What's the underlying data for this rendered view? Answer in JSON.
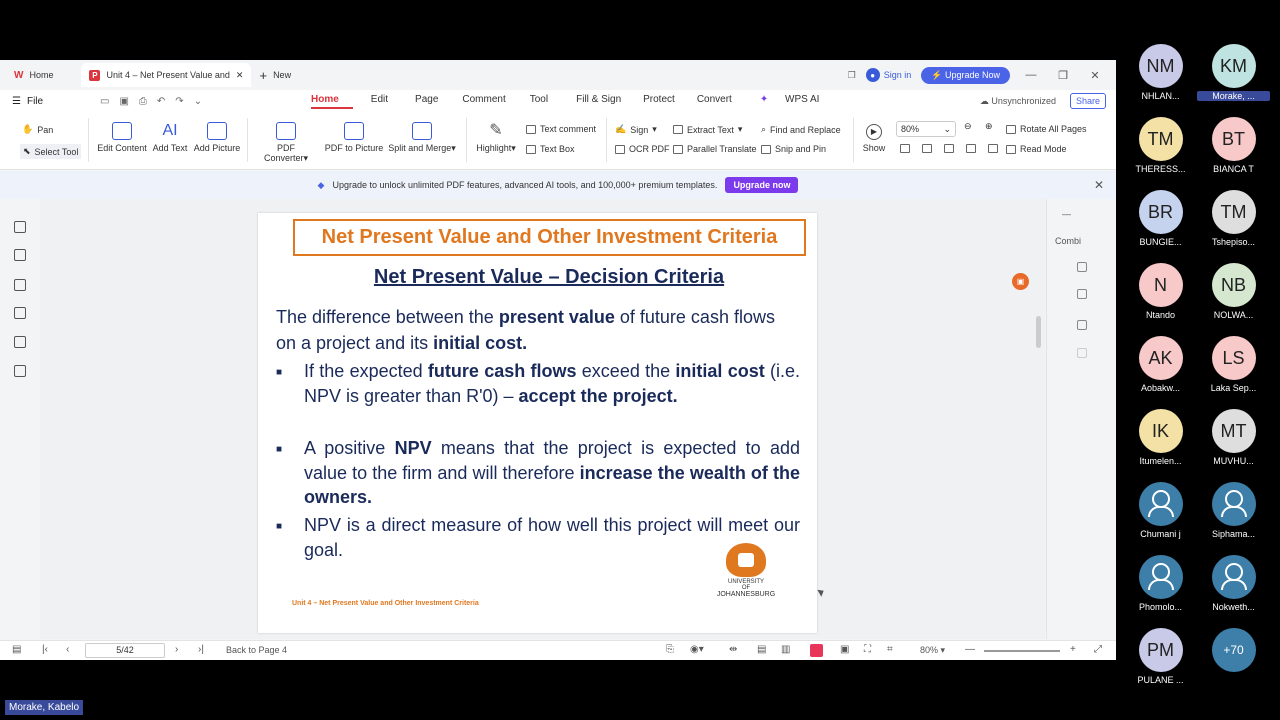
{
  "tabs": {
    "home": "Home",
    "active_doc": "Unit 4 – Net Present Value and",
    "new": "New"
  },
  "top_right": {
    "sign_in": "Sign in",
    "upgrade_now": "Upgrade Now"
  },
  "menu": {
    "file": "File",
    "tabs": [
      "Home",
      "Edit",
      "Page",
      "Comment",
      "Tool",
      "Fill & Sign",
      "Protect",
      "Convert",
      "WPS AI"
    ],
    "unsynchronized": "Unsynchronized",
    "share": "Share"
  },
  "ribbon": {
    "pan": "Pan",
    "select_tool": "Select Tool",
    "edit_content": "Edit Content",
    "add_text": "Add Text",
    "add_picture": "Add Picture",
    "pdf_converter": "PDF Converter",
    "pdf_to_picture": "PDF to Picture",
    "split_merge": "Split and Merge",
    "highlight": "Highlight",
    "text_comment": "Text comment",
    "text_box": "Text Box",
    "sign": "Sign",
    "ocr_pdf": "OCR PDF",
    "extract_text": "Extract Text",
    "parallel_translate": "Parallel Translate",
    "find_replace": "Find and Replace",
    "snip_pin": "Snip and Pin",
    "show": "Show",
    "zoom": "80%",
    "rotate_all": "Rotate All Pages",
    "read_mode": "Read Mode"
  },
  "banner": {
    "text": "Upgrade to unlock unlimited PDF features, advanced AI tools, and 100,000+ premium templates.",
    "button": "Upgrade now"
  },
  "slide": {
    "title": "Net Present Value and Other Investment Criteria",
    "subtitle": "Net Present Value – Decision Criteria",
    "intro_a": "The difference between the ",
    "intro_b": "present value",
    "intro_c": " of future cash flows on a project and its ",
    "intro_d": "initial cost.",
    "b1_a": "If the expected ",
    "b1_b": "future cash flows",
    "b1_c": " exceed the ",
    "b1_d": "initial cost",
    "b1_e": " (i.e. NPV is greater than R'0) – ",
    "b1_f": "accept the project.",
    "b2_a": "A positive ",
    "b2_b": "NPV",
    "b2_c": " means that the project is expected to add value to the firm and will therefore ",
    "b2_d": "increase the wealth of the owners.",
    "b3": "NPV is a direct measure of how well this project will meet our goal.",
    "footer": "Unit 4 – Net Present Value and Other Investment Criteria",
    "uni_line1": "UNIVERSITY",
    "uni_line2": "OF",
    "uni_line3": "JOHANNESBURG"
  },
  "right_panel": {
    "combi": "Combi"
  },
  "status": {
    "page": "5/42",
    "back": "Back to Page 4",
    "zoom": "80%"
  },
  "participants": [
    {
      "initials": "NM",
      "name": "NHLAN...",
      "color": "#c9c9e8"
    },
    {
      "initials": "KM",
      "name": "Morake, ...",
      "color": "#bfe3e0"
    },
    {
      "initials": "TM",
      "name": "THERESS...",
      "color": "#f3e1a6"
    },
    {
      "initials": "BT",
      "name": "BIANCA T",
      "color": "#f7c9c9"
    },
    {
      "initials": "BR",
      "name": "BUNGIE...",
      "color": "#c6d3ef"
    },
    {
      "initials": "TM",
      "name": "Tshepiso...",
      "color": "#dedede"
    },
    {
      "initials": "N",
      "name": "Ntando",
      "color": "#f7c9c9"
    },
    {
      "initials": "NB",
      "name": "NOLWA...",
      "color": "#d5e8cf"
    },
    {
      "initials": "AK",
      "name": "Aobakw...",
      "color": "#f7c9c9"
    },
    {
      "initials": "LS",
      "name": "Laka Sep...",
      "color": "#f7c9c9"
    },
    {
      "initials": "IK",
      "name": "Itumelen...",
      "color": "#f3e1a6"
    },
    {
      "initials": "MT",
      "name": "MUVHU...",
      "color": "#dedede"
    },
    {
      "initials": "",
      "name": "Chumani j",
      "color": "#3d7fa8"
    },
    {
      "initials": "",
      "name": "Siphama...",
      "color": "#3d7fa8"
    },
    {
      "initials": "",
      "name": "Phomolo...",
      "color": "#3d7fa8"
    },
    {
      "initials": "",
      "name": "Nokweth...",
      "color": "#3d7fa8"
    },
    {
      "initials": "PM",
      "name": "PULANE ...",
      "color": "#c9c9e8"
    },
    {
      "initials": "+70",
      "name": "",
      "color": "#3d7fa8"
    }
  ],
  "speaker": "Morake, Kabelo"
}
